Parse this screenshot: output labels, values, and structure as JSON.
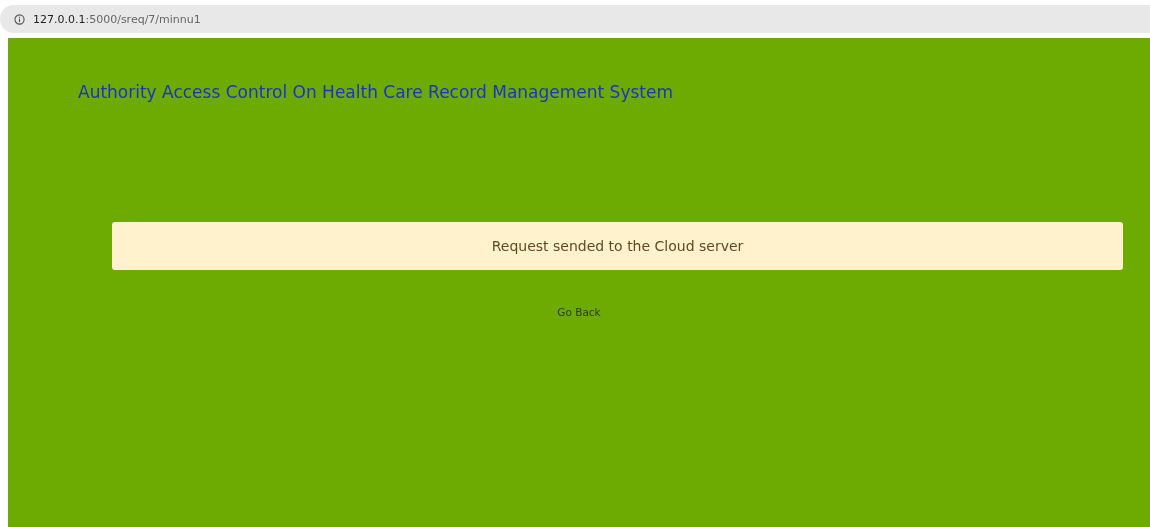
{
  "address_bar": {
    "url_host": "127.0.0.1",
    "url_path": ":5000/sreq/7/minnu1"
  },
  "header": {
    "title": "Authority Access Control On Health Care Record Management System"
  },
  "alert": {
    "message": "Request sended to the Cloud server"
  },
  "link": {
    "label": "Go Back"
  }
}
